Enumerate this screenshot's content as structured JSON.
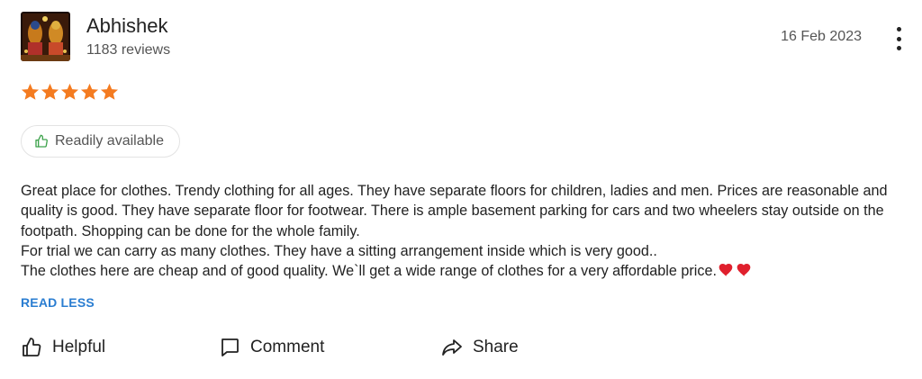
{
  "reviewer": {
    "name": "Abhishek",
    "review_count": "1183 reviews",
    "avatar_icon": "avatar-image"
  },
  "review": {
    "date": "16 Feb 2023",
    "rating": 5,
    "rating_max": 5,
    "star_color": "#f47b20",
    "tag": {
      "label": "Readily available",
      "icon": "thumbs-up-icon",
      "icon_color": "#3fa34d"
    },
    "text_lines": [
      "Great place for clothes. Trendy clothing for all ages. They have separate floors for children, ladies and men. Prices are reasonable and quality is good. They have separate floor for footwear. There is ample basement parking for cars and two wheelers stay outside on the footpath. Shopping can be done for the whole family.",
      "For trial we can carry as many clothes. They have a sitting arrangement inside which is very good..",
      "The clothes here are cheap and of good quality. We`ll get a wide range of clothes for a very affordable price."
    ],
    "emoji": [
      "red-heart",
      "red-heart"
    ],
    "read_less_label": "READ LESS",
    "link_color": "#2a7dd1"
  },
  "actions": {
    "helpful_label": "Helpful",
    "comment_label": "Comment",
    "share_label": "Share"
  }
}
